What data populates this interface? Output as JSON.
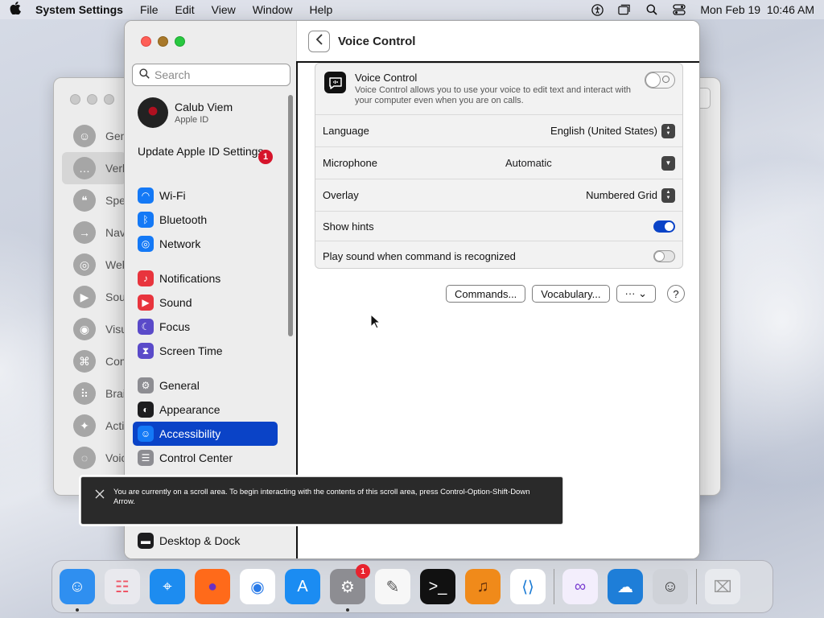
{
  "menubar": {
    "app_name": "System Settings",
    "menus": [
      "File",
      "Edit",
      "View",
      "Window",
      "Help"
    ],
    "datetime": "Mon Feb 19  10:46 AM"
  },
  "background_window": {
    "items": [
      {
        "label": "Gen",
        "icon": "person-icon"
      },
      {
        "label": "Verb",
        "icon": "speech-bubble-icon"
      },
      {
        "label": "Spe",
        "icon": "speech-icon"
      },
      {
        "label": "Nav",
        "icon": "arrow-right-icon"
      },
      {
        "label": "Web",
        "icon": "globe-icon"
      },
      {
        "label": "Sou",
        "icon": "speaker-icon"
      },
      {
        "label": "Visu",
        "icon": "eye-icon"
      },
      {
        "label": "Com",
        "icon": "command-icon"
      },
      {
        "label": "Brai",
        "icon": "braille-icon"
      },
      {
        "label": "Acti",
        "icon": "activities-icon"
      },
      {
        "label": "Voic",
        "icon": "voice-icon"
      }
    ]
  },
  "sidebar": {
    "search_placeholder": "Search",
    "account_name": "Calub Viem",
    "account_sub": "Apple ID",
    "update_label": "Update Apple ID Settings",
    "update_badge": "1",
    "groups": [
      [
        {
          "label": "Wi-Fi",
          "icon": "wifi-icon",
          "color": "#1479f6"
        },
        {
          "label": "Bluetooth",
          "icon": "bluetooth-icon",
          "color": "#1479f6"
        },
        {
          "label": "Network",
          "icon": "globe-icon",
          "color": "#1479f6"
        }
      ],
      [
        {
          "label": "Notifications",
          "icon": "bell-icon",
          "color": "#e8343d"
        },
        {
          "label": "Sound",
          "icon": "speaker-icon",
          "color": "#e8343d"
        },
        {
          "label": "Focus",
          "icon": "moon-icon",
          "color": "#5a4ac9"
        },
        {
          "label": "Screen Time",
          "icon": "hourglass-icon",
          "color": "#5a4ac9"
        }
      ],
      [
        {
          "label": "General",
          "icon": "gear-icon",
          "color": "#8d8d92"
        },
        {
          "label": "Appearance",
          "icon": "appearance-icon",
          "color": "#1d1d1f"
        },
        {
          "label": "Accessibility",
          "icon": "accessibility-icon",
          "color": "#1479f6",
          "selected": true
        },
        {
          "label": "Control Center",
          "icon": "control-center-icon",
          "color": "#8d8d92"
        }
      ]
    ],
    "bottom_item": {
      "label": "Desktop & Dock",
      "icon": "dock-icon",
      "color": "#1d1d1f"
    }
  },
  "content": {
    "title": "Voice Control",
    "voice_control": {
      "title": "Voice Control",
      "description": "Voice Control allows you to use your voice to edit text and interact with your computer even when you are on calls.",
      "enabled": false
    },
    "rows": [
      {
        "label": "Language",
        "value": "English (United States)",
        "control": "stepper"
      },
      {
        "label": "Microphone",
        "value": "Automatic",
        "control": "dropdown"
      },
      {
        "label": "Overlay",
        "value": "Numbered Grid",
        "control": "stepper"
      },
      {
        "label": "Show hints",
        "value": "",
        "control": "toggle",
        "on": true
      },
      {
        "label": "Play sound when command is recognized",
        "value": "",
        "control": "toggle",
        "on": false
      }
    ],
    "buttons": {
      "commands": "Commands...",
      "vocabulary": "Vocabulary...",
      "more": "··· ⌄",
      "help": "?"
    }
  },
  "caption": {
    "text": "You are currently on a scroll area. To begin interacting with the contents of this scroll area, press Control-Option-Shift-Down Arrow."
  },
  "dock": {
    "apps": [
      {
        "name": "Finder",
        "icon": "finder-icon",
        "running": true
      },
      {
        "name": "Launchpad",
        "icon": "launchpad-icon",
        "running": false
      },
      {
        "name": "Safari",
        "icon": "safari-icon",
        "running": false
      },
      {
        "name": "Firefox",
        "icon": "firefox-icon",
        "running": false
      },
      {
        "name": "Chrome",
        "icon": "chrome-icon",
        "running": false
      },
      {
        "name": "App Store",
        "icon": "app-store-icon",
        "running": false
      },
      {
        "name": "System Settings",
        "icon": "system-settings-icon",
        "running": true,
        "badge": "1"
      },
      {
        "name": "TextEdit",
        "icon": "textedit-icon",
        "running": false
      },
      {
        "name": "Terminal",
        "icon": "terminal-icon",
        "running": false
      },
      {
        "name": "GarageBand",
        "icon": "garageband-icon",
        "running": false
      },
      {
        "name": "VS Code",
        "icon": "vscode-icon",
        "running": false
      }
    ],
    "extras": [
      {
        "name": "Visual Studio",
        "icon": "visual-studio-icon"
      },
      {
        "name": "Weather",
        "icon": "weather-icon"
      },
      {
        "name": "Accessibility Inspector",
        "icon": "accessibility-inspector-icon"
      }
    ],
    "trash": {
      "name": "Trash",
      "icon": "trash-icon"
    }
  }
}
